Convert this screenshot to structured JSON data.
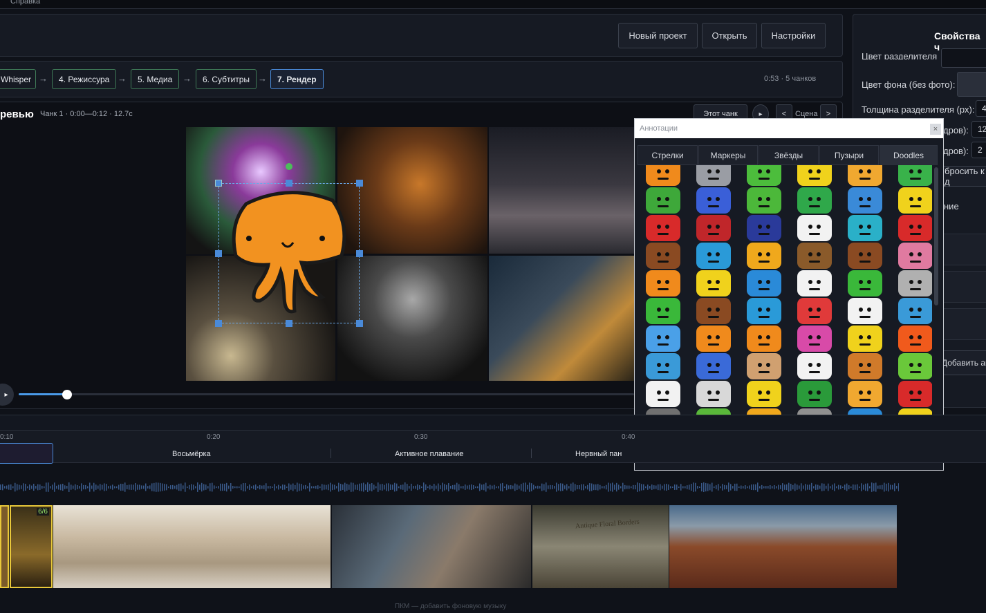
{
  "menubar": {
    "help": "Справка"
  },
  "toolbar": {
    "new_project": "Новый проект",
    "open": "Открыть",
    "settings": "Настройки"
  },
  "pipeline": {
    "steps": [
      "Whisper",
      "4. Режиссура",
      "5. Медиа",
      "6. Субтитры",
      "7. Рендер"
    ],
    "arrow": "→",
    "status": "0:53 · 5 чанков"
  },
  "preview": {
    "title": "ревью",
    "chunk_info": "Чанк 1 · 0:00—0:12 · 12.7с",
    "this_chunk": "Этот чанк",
    "scene_label": "Сцена",
    "prev": "<",
    "next": ">",
    "play": "▸",
    "progress": 0.09
  },
  "right_panel": {
    "title": "Свойства ч",
    "divider_color": "Цвет разделителя",
    "bg_color": "Цвет фона (без фото):",
    "divider_thickness": "Толщина разделителя (px):",
    "divider_thickness_value": "4",
    "frames_a": "дров):",
    "frames_a_value": "12",
    "frames_b": "дров):",
    "frames_b_value": "2",
    "reset": "бросить к д",
    "item_label": "ние",
    "add_annotation": "Добавить ан"
  },
  "annotations": {
    "title": "Аннотации",
    "close": "×",
    "tabs": [
      "Стрелки",
      "Маркеры",
      "Звёзды",
      "Пузыри",
      "Doodles"
    ],
    "active_tab": "Doodles",
    "doodle_colors": [
      "#f08a1c",
      "#9a9da4",
      "#4cbd3c",
      "#f0d21c",
      "#f0a830",
      "#39b24a",
      "#3ea83a",
      "#3a5fd8",
      "#4cb83a",
      "#2fa84a",
      "#3a8ad8",
      "#f0d21c",
      "#d82a2a",
      "#c0262a",
      "#2a3a9a",
      "#f2f2f2",
      "#2ab0c8",
      "#d82a2a",
      "#8a4a22",
      "#2a9ad8",
      "#f0a81c",
      "#8a5a2a",
      "#8a4a22",
      "#e07aa0",
      "#f08a1c",
      "#f0d21c",
      "#2a8ad8",
      "#f2f2f2",
      "#3ab83a",
      "#b0b0b0",
      "#3ab83a",
      "#8a4a22",
      "#2a9ad8",
      "#e03a3a",
      "#f2f2f2",
      "#3a9ad8",
      "#4aa0e8",
      "#f08a1c",
      "#f08a1c",
      "#d84aa8",
      "#f0d21c",
      "#f05a1c",
      "#3a9ad8",
      "#3a6ad8",
      "#d0a070",
      "#f2f2f2",
      "#d07a2a",
      "#6ac83a",
      "#f2f2f2",
      "#d8d8d8",
      "#f0d21c",
      "#2a9a3a",
      "#f0a830",
      "#d82a2a",
      "#707070",
      "#5ab83a",
      "#f0a81c",
      "#909090",
      "#2a8ad8",
      "#f0d21c",
      "#909090",
      "#f2f2f2",
      "#6ac83a",
      "#3ab83a",
      "#d82a2a",
      "#2a6ad8"
    ]
  },
  "timeline": {
    "ticks": [
      "0:10",
      "0:20",
      "0:30",
      "0:40"
    ],
    "segments": [
      "Восьмёрка",
      "Активное плавание",
      "Нервный пан"
    ],
    "badge": "6/6",
    "hint": "ПКМ — добавить фоновую музыку",
    "film_caption": "Antique Floral Borders"
  }
}
